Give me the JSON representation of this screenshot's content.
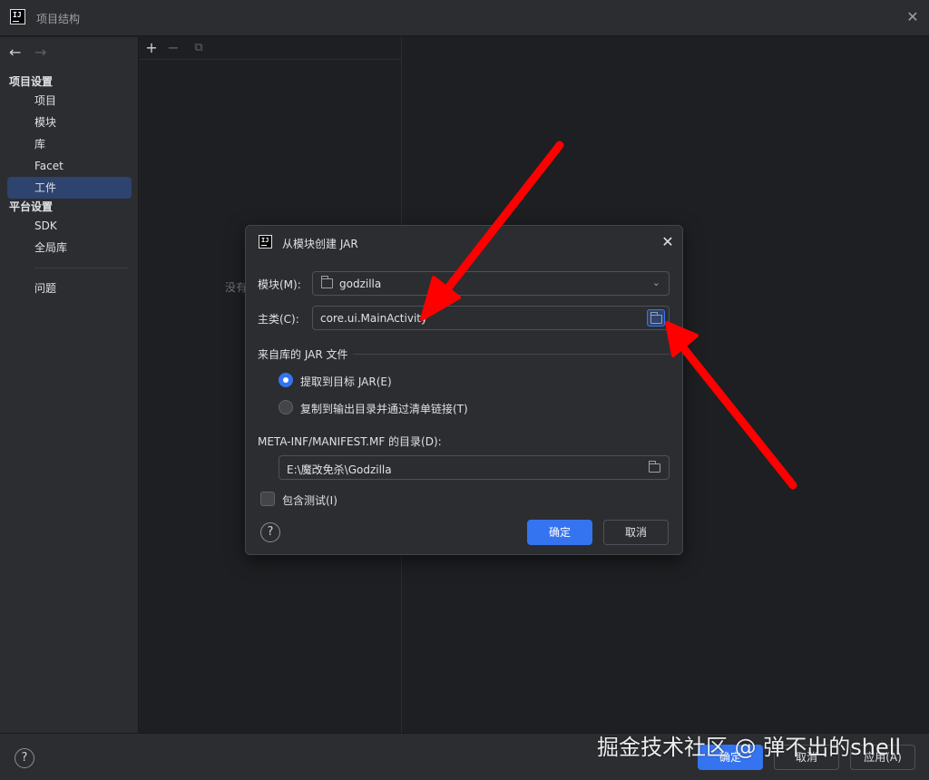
{
  "window": {
    "title": "项目结构"
  },
  "sidebar": {
    "sections": [
      {
        "title": "项目设置",
        "items": [
          "项目",
          "模块",
          "库",
          "Facet",
          "工件"
        ]
      },
      {
        "title": "平台设置",
        "items": [
          "SDK",
          "全局库"
        ]
      }
    ],
    "extra_item": "问题",
    "selected_item": "工件"
  },
  "middle_panel": {
    "empty_text": "没有"
  },
  "bottom_bar": {
    "help": "?",
    "ok_label": "确定",
    "cancel_label": "取消",
    "apply_label": "应用(A)"
  },
  "dialog": {
    "title": "从模块创建 JAR",
    "module_label": "模块(M):",
    "module_value": "godzilla",
    "main_class_label": "主类(C):",
    "main_class_value": "core.ui.MainActivity",
    "jar_group_title": "来自库的 JAR 文件",
    "radio_options": [
      {
        "label": "提取到目标 JAR(E)",
        "selected": true
      },
      {
        "label": "复制到输出目录并通过清单链接(T)",
        "selected": false
      }
    ],
    "manifest_label": "META-INF/MANIFEST.MF 的目录(D):",
    "manifest_value": "E:\\魔改免杀\\Godzilla",
    "include_tests_label": "包含测试(I)",
    "include_tests_checked": false,
    "help": "?",
    "ok_label": "确定",
    "cancel_label": "取消"
  },
  "watermark": "掘金技术社区 @ 弹不出的shell",
  "colors": {
    "accent": "#3574f0",
    "selection": "#2e436e",
    "annotation": "#ff0000"
  }
}
